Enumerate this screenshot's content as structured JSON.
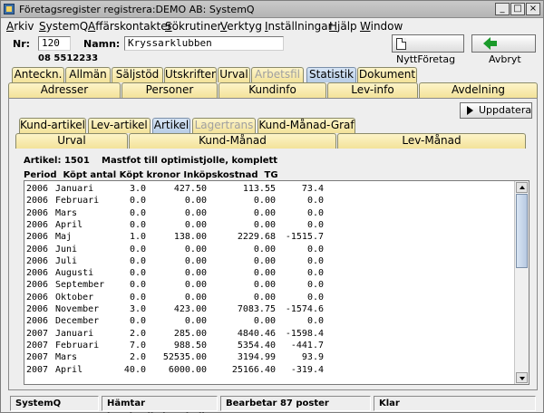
{
  "window": {
    "title": "Företagsregister registrera:DEMO AB: SystemQ"
  },
  "menu": [
    "Arkiv",
    "SystemQ",
    "Affärskontakter",
    "Sökrutiner",
    "Verktyg",
    "Inställningar",
    "Hjälp",
    "Window"
  ],
  "header": {
    "nr_label": "Nr:",
    "nr_value": "120",
    "name_label": "Namn:",
    "name_value": "Kryssarklubben",
    "phone": "08 5512233",
    "new_company_button": "NyttFöretag",
    "cancel_button": "Avbryt"
  },
  "tabs_row1": [
    {
      "label": "Anteckn.",
      "state": "normal"
    },
    {
      "label": "Allmän",
      "state": "normal"
    },
    {
      "label": "Säljstöd",
      "state": "normal"
    },
    {
      "label": "Utskrifter",
      "state": "normal"
    },
    {
      "label": "Urval",
      "state": "normal"
    },
    {
      "label": "Arbetsfil",
      "state": "disabled"
    },
    {
      "label": "Statistik",
      "state": "active"
    },
    {
      "label": "Dokument",
      "state": "normal"
    }
  ],
  "tabs_row2": [
    "Adresser",
    "Personer",
    "Kundinfo",
    "Lev-info",
    "Avdelning"
  ],
  "subtabs_row1": [
    {
      "label": "Kund-artikel",
      "state": "normal"
    },
    {
      "label": "Lev-artikel",
      "state": "normal"
    },
    {
      "label": "Artikel",
      "state": "active"
    },
    {
      "label": "Lagertrans",
      "state": "disabled"
    },
    {
      "label": "Kund-Månad-Graf",
      "state": "normal"
    }
  ],
  "subtabs_row2": [
    "Urval",
    "Kund-Månad",
    "Lev-Månad"
  ],
  "update_button": "Uppdatera",
  "article": {
    "label": "Artikel: 1501",
    "description": "Mastfot till optimistjolle, komplett"
  },
  "columns": "Period  Köpt antal Köpt kronor Inköpskostnad  TG",
  "rows": [
    {
      "year": "2006",
      "month": "Januari",
      "qty": "3.0",
      "kr": "427.50",
      "cost": "113.55",
      "tg": "73.4"
    },
    {
      "year": "2006",
      "month": "Februari",
      "qty": "0.0",
      "kr": "0.00",
      "cost": "0.00",
      "tg": "0.0"
    },
    {
      "year": "2006",
      "month": "Mars",
      "qty": "0.0",
      "kr": "0.00",
      "cost": "0.00",
      "tg": "0.0"
    },
    {
      "year": "2006",
      "month": "April",
      "qty": "0.0",
      "kr": "0.00",
      "cost": "0.00",
      "tg": "0.0"
    },
    {
      "year": "2006",
      "month": "Maj",
      "qty": "1.0",
      "kr": "138.00",
      "cost": "2229.68",
      "tg": "-1515.7"
    },
    {
      "year": "2006",
      "month": "Juni",
      "qty": "0.0",
      "kr": "0.00",
      "cost": "0.00",
      "tg": "0.0"
    },
    {
      "year": "2006",
      "month": "Juli",
      "qty": "0.0",
      "kr": "0.00",
      "cost": "0.00",
      "tg": "0.0"
    },
    {
      "year": "2006",
      "month": "Augusti",
      "qty": "0.0",
      "kr": "0.00",
      "cost": "0.00",
      "tg": "0.0"
    },
    {
      "year": "2006",
      "month": "September",
      "qty": "0.0",
      "kr": "0.00",
      "cost": "0.00",
      "tg": "0.0"
    },
    {
      "year": "2006",
      "month": "Oktober",
      "qty": "0.0",
      "kr": "0.00",
      "cost": "0.00",
      "tg": "0.0"
    },
    {
      "year": "2006",
      "month": "November",
      "qty": "3.0",
      "kr": "423.00",
      "cost": "7083.75",
      "tg": "-1574.6"
    },
    {
      "year": "2006",
      "month": "December",
      "qty": "0.0",
      "kr": "0.00",
      "cost": "0.00",
      "tg": "0.0"
    },
    {
      "year": "2007",
      "month": "Januari",
      "qty": "2.0",
      "kr": "285.00",
      "cost": "4840.46",
      "tg": "-1598.4"
    },
    {
      "year": "2007",
      "month": "Februari",
      "qty": "7.0",
      "kr": "988.50",
      "cost": "5354.40",
      "tg": "-441.7"
    },
    {
      "year": "2007",
      "month": "Mars",
      "qty": "2.0",
      "kr": "52535.00",
      "cost": "3194.99",
      "tg": "93.9"
    },
    {
      "year": "2007",
      "month": "April",
      "qty": "40.0",
      "kr": "6000.00",
      "cost": "25166.40",
      "tg": "-319.4"
    }
  ],
  "status": [
    "SystemQ",
    "Hämtar kundartikelstatistik",
    "Bearbetar 87 poster",
    "Klar"
  ]
}
